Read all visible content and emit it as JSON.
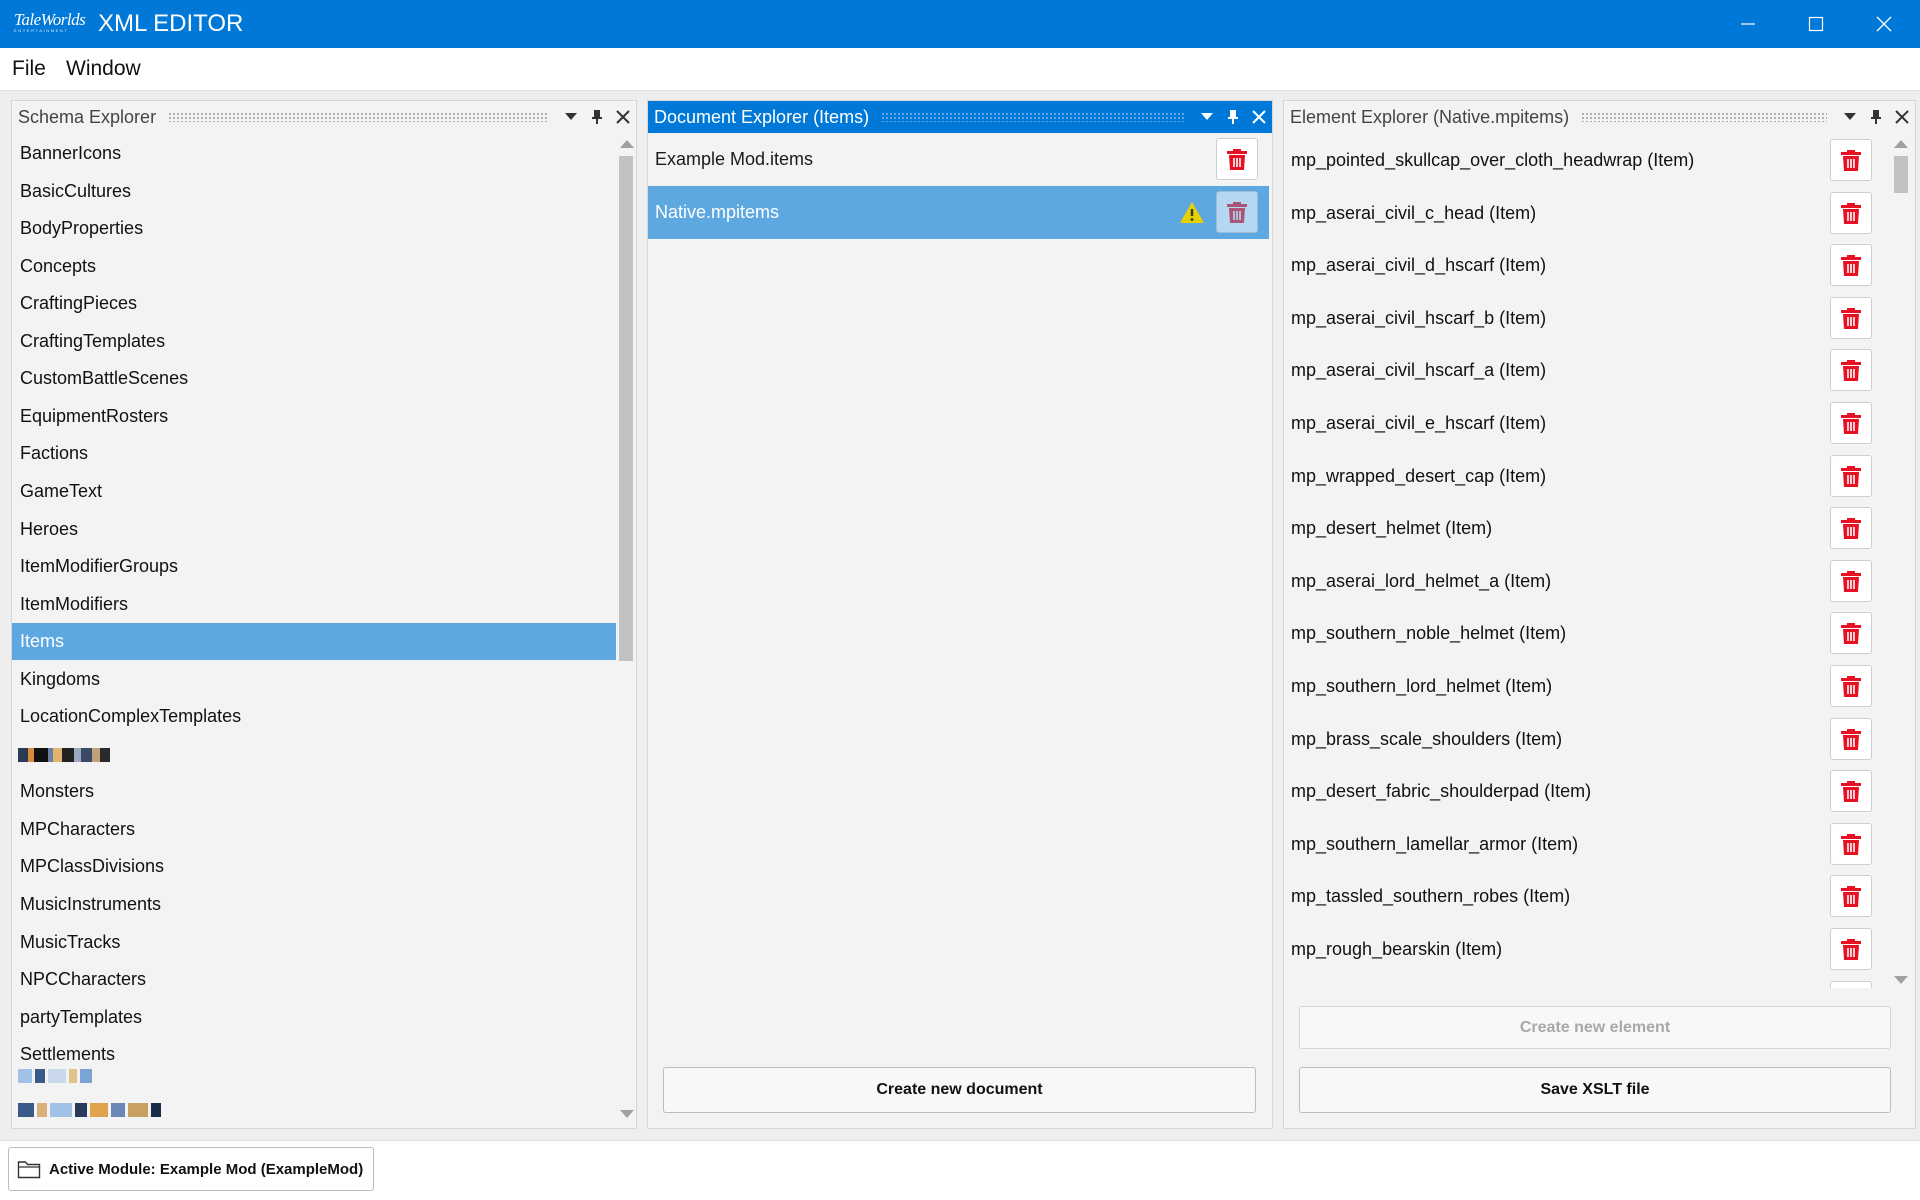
{
  "window": {
    "logo_text": "TaleWorlds",
    "logo_subtext": "ENTERTAINMENT",
    "title": "XML EDITOR",
    "controls": [
      "minimize-icon",
      "maximize-icon",
      "close-icon"
    ]
  },
  "menu": [
    {
      "label": "File"
    },
    {
      "label": "Window"
    }
  ],
  "schema_explorer": {
    "title": "Schema Explorer",
    "items": [
      "BannerIcons",
      "BasicCultures",
      "BodyProperties",
      "Concepts",
      "CraftingPieces",
      "CraftingTemplates",
      "CustomBattleScenes",
      "EquipmentRosters",
      "Factions",
      "GameText",
      "Heroes",
      "ItemModifierGroups",
      "ItemModifiers",
      "Items",
      "Kingdoms",
      "LocationComplexTemplates",
      "",
      "Monsters",
      "MPCharacters",
      "MPClassDivisions",
      "MusicInstruments",
      "MusicTracks",
      "NPCCharacters",
      "partyTemplates",
      "Settlements"
    ],
    "selected": "Items",
    "scroll_position": 0.45
  },
  "document_explorer": {
    "title": "Document Explorer (Items)",
    "documents": [
      {
        "name": "Example Mod.items",
        "warning": false
      },
      {
        "name": "Native.mpitems",
        "warning": true
      }
    ],
    "selected": "Native.mpitems",
    "create_label": "Create new document"
  },
  "element_explorer": {
    "title": "Element Explorer (Native.mpitems)",
    "elements": [
      "mp_pointed_skullcap_over_cloth_headwrap (Item)",
      "mp_aserai_civil_c_head (Item)",
      "mp_aserai_civil_d_hscarf (Item)",
      "mp_aserai_civil_hscarf_b (Item)",
      "mp_aserai_civil_hscarf_a (Item)",
      "mp_aserai_civil_e_hscarf (Item)",
      "mp_wrapped_desert_cap (Item)",
      "mp_desert_helmet (Item)",
      "mp_aserai_lord_helmet_a (Item)",
      "mp_southern_noble_helmet (Item)",
      "mp_southern_lord_helmet (Item)",
      "mp_brass_scale_shoulders (Item)",
      "mp_desert_fabric_shoulderpad (Item)",
      "mp_southern_lamellar_armor (Item)",
      "mp_tassled_southern_robes (Item)",
      "mp_rough_bearskin (Item)"
    ],
    "create_label": "Create new element",
    "save_label": "Save XSLT file"
  },
  "status": {
    "module_label": "Active Module: Example Mod (ExampleMod)"
  },
  "colors": {
    "accent": "#0078d7",
    "selection": "#5ea8e2",
    "delete_red": "#e81123",
    "warning_yellow": "#e8d100"
  }
}
